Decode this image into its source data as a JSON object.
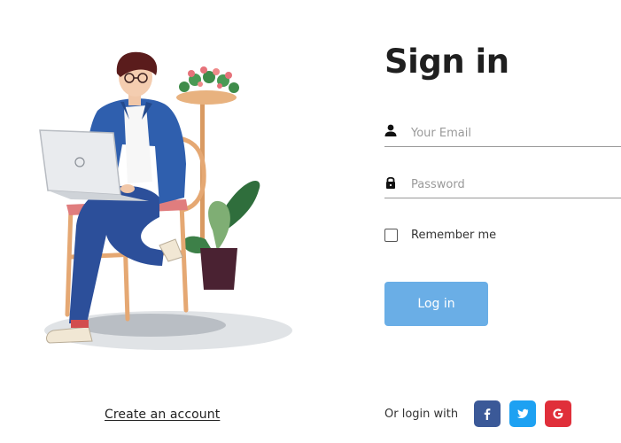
{
  "form": {
    "title": "Sign in",
    "email_placeholder": "Your Email",
    "password_placeholder": "Password",
    "remember_label": "Remember me",
    "login_label": "Log in"
  },
  "footer": {
    "create_account": "Create an account",
    "or_login_with": "Or login with",
    "social": [
      {
        "icon": "facebook-icon",
        "color": "#3b5998"
      },
      {
        "icon": "twitter-icon",
        "color": "#1da1f2"
      },
      {
        "icon": "google-icon",
        "color": "#e02f3a"
      }
    ]
  },
  "colors": {
    "primary_button": "#6aaee6",
    "text": "#222222"
  },
  "illustration": {
    "icon": "person-with-laptop-illustration"
  }
}
